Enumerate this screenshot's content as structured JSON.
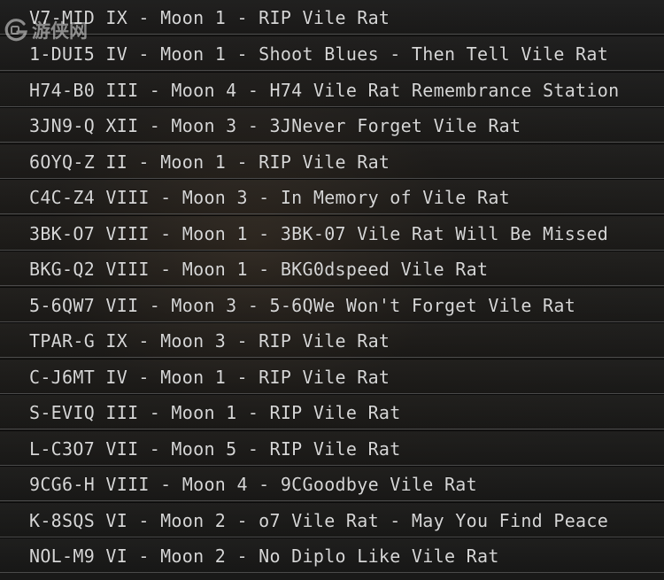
{
  "rows": [
    "V7-MID IX - Moon 1 - RIP Vile Rat",
    "1-DUI5 IV - Moon 1 - Shoot Blues - Then Tell Vile Rat",
    "H74-B0 III - Moon 4 - H74 Vile Rat Remembrance Station",
    "3JN9-Q XII - Moon 3 - 3JNever Forget Vile Rat",
    "6OYQ-Z II - Moon 1 - RIP Vile Rat",
    "C4C-Z4 VIII - Moon 3 - In Memory of Vile Rat",
    "3BK-O7 VIII - Moon 1 - 3BK-07 Vile Rat Will Be Missed",
    "BKG-Q2 VIII - Moon 1 - BKG0dspeed Vile Rat",
    "5-6QW7 VII - Moon 3 - 5-6QWe Won't Forget Vile Rat",
    "TPAR-G IX - Moon 3 - RIP Vile Rat",
    "C-J6MT IV - Moon 1 - RIP Vile Rat",
    "S-EVIQ III - Moon 1 - RIP Vile Rat",
    "L-C3O7 VII - Moon 5 - RIP Vile Rat",
    "9CG6-H VIII - Moon 4 - 9CGoodbye Vile Rat",
    "K-8SQS VI - Moon 2 - o7 Vile Rat - May You Find Peace",
    "NOL-M9 VI - Moon 2 - No Diplo Like Vile Rat"
  ],
  "watermark": {
    "text": "游侠网",
    "icon": "gamersky-logo-icon"
  }
}
